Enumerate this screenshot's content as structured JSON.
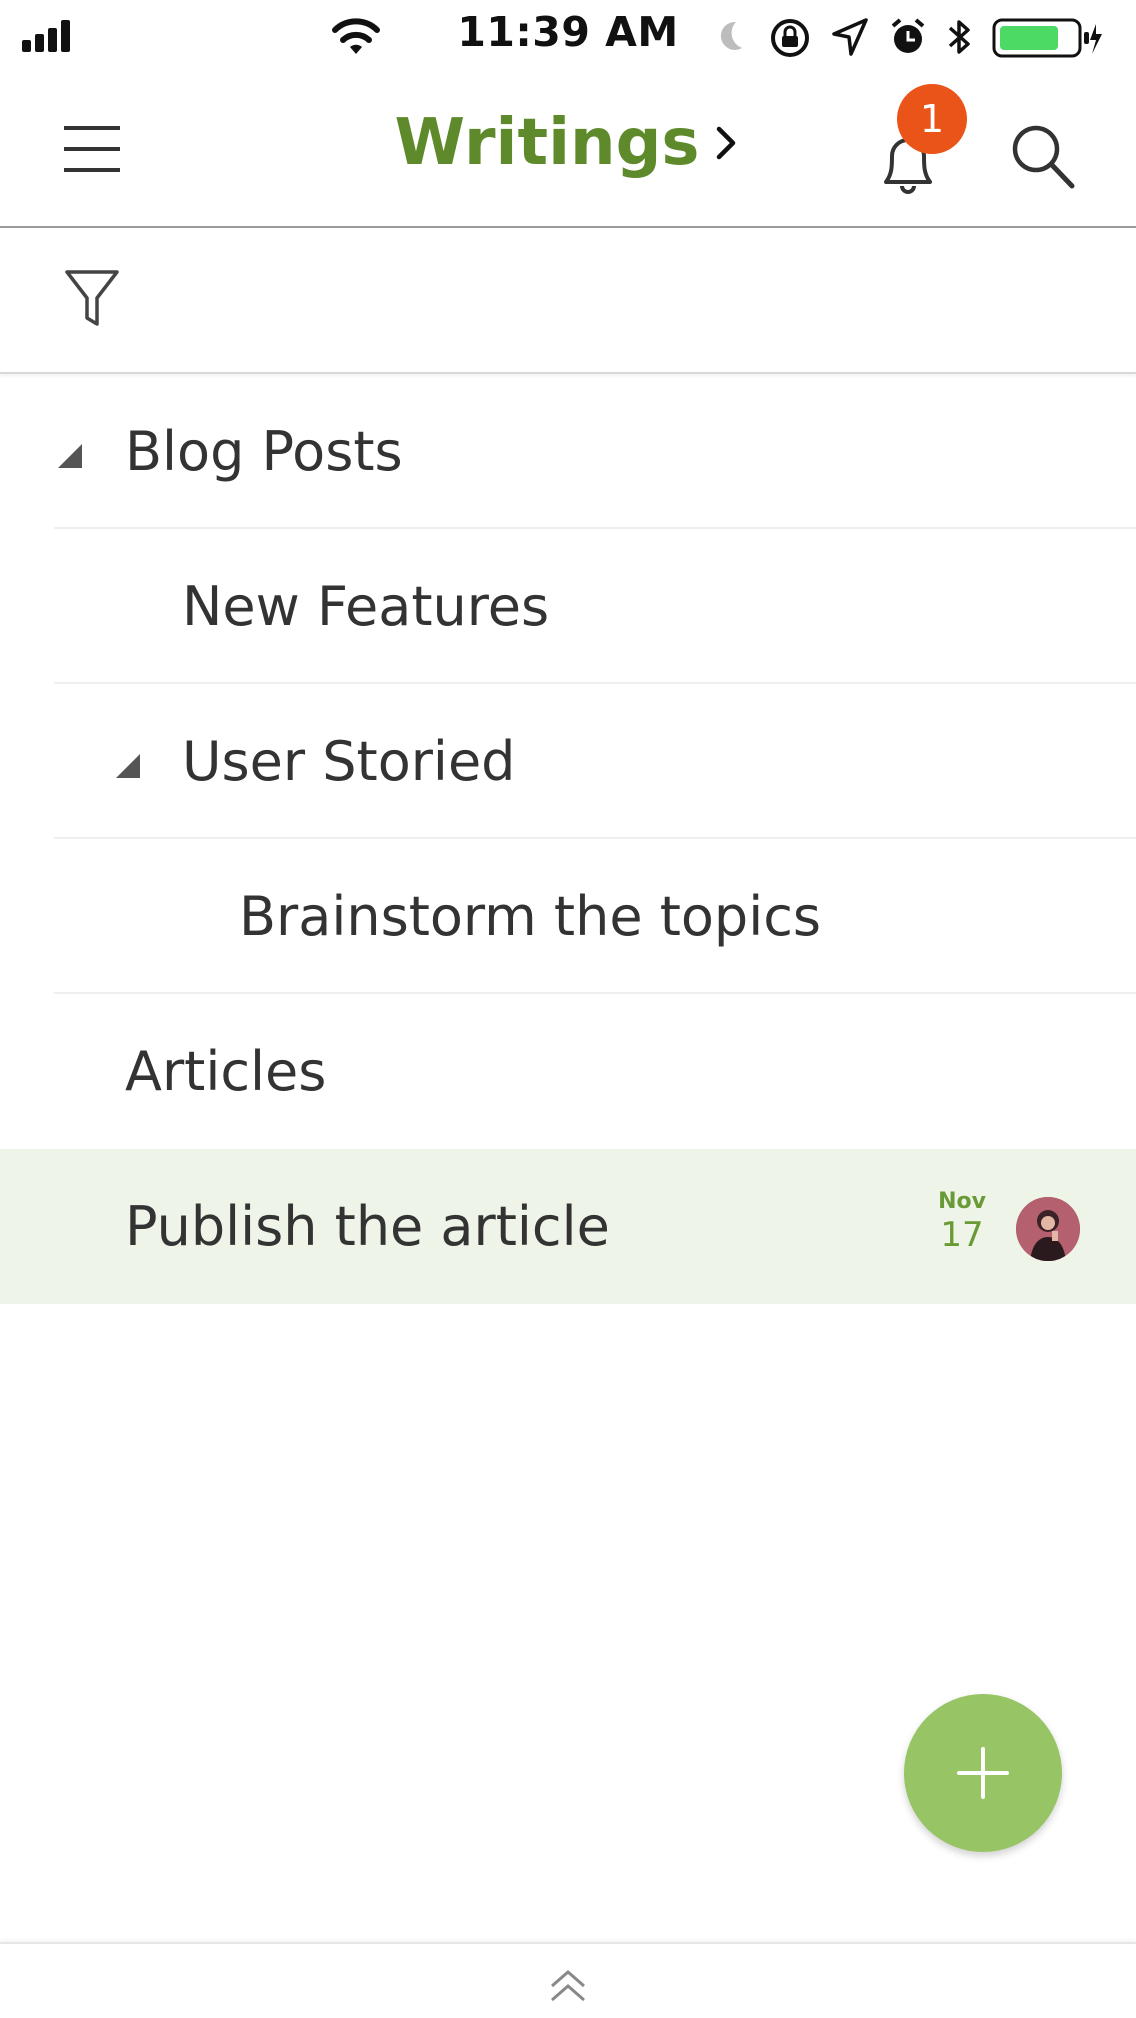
{
  "status_bar": {
    "time": "11:39 AM"
  },
  "header": {
    "title": "Writings",
    "notification_count": "1",
    "accent_color": "#5f8a2b",
    "badge_color": "#ea5419",
    "icons": [
      "hamburger-menu-icon",
      "chevron-right-icon",
      "bell-icon",
      "search-icon"
    ]
  },
  "filter_bar": {
    "icon": "filter-icon"
  },
  "tasks": [
    {
      "label": "Blog Posts",
      "level": 0,
      "collapsible": true
    },
    {
      "label": "New Features",
      "level": 1,
      "collapsible": false
    },
    {
      "label": "User Storied",
      "level": 1,
      "collapsible": true
    },
    {
      "label": "Brainstorm the topics",
      "level": 2,
      "collapsible": false
    },
    {
      "label": "Articles",
      "level": 0,
      "collapsible": false
    },
    {
      "label": "Publish the article",
      "level": 0,
      "collapsible": false,
      "selected": true,
      "due_month": "Nov",
      "due_day": "17",
      "has_avatar": true
    }
  ],
  "fab": {
    "icon": "plus-icon",
    "color": "#97c464"
  },
  "bottom_bar": {
    "icon": "double-chevron-up-icon"
  }
}
